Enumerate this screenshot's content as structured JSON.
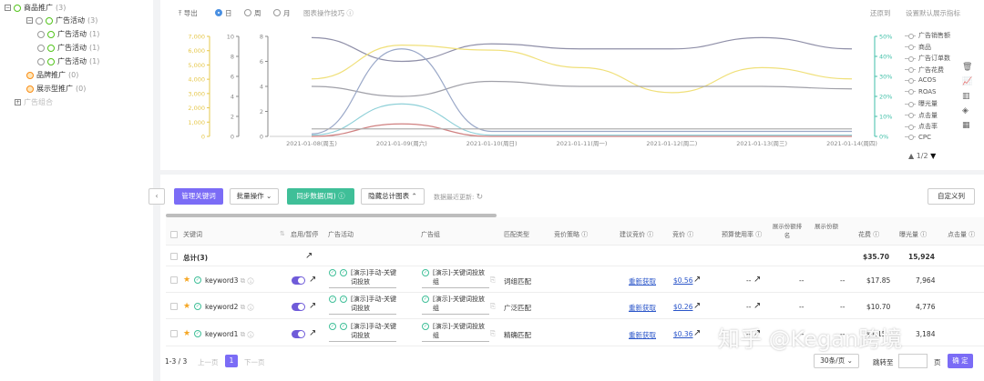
{
  "tree": {
    "items": [
      {
        "label": "商品推广",
        "count": "(3)"
      },
      {
        "label": "广告活动",
        "count": "(3)"
      },
      {
        "label": "广告活动",
        "count": "(1)"
      },
      {
        "label": "广告活动",
        "count": "(1)"
      },
      {
        "label": "广告活动",
        "count": "(1)"
      },
      {
        "label": "品牌推广",
        "count": "(0)"
      },
      {
        "label": "展示型推广",
        "count": "(0)"
      },
      {
        "label": "广告组合",
        "count": ""
      }
    ]
  },
  "chart_toolbar": {
    "export": "导出",
    "day": "日",
    "week": "周",
    "month": "月",
    "hint": "图表操作技巧",
    "rebase": "还原到",
    "settings": "设置默认展示指标"
  },
  "chart_data": {
    "type": "line",
    "x": [
      "2021-01-08(周五)",
      "2021-01-09(周六)",
      "2021-01-10(周日)",
      "2021-01-11(周一)",
      "2021-01-12(周二)",
      "2021-01-13(周三)",
      "2021-01-14(周四)"
    ],
    "y_axes": [
      {
        "ticks": [
          "0",
          "1,000",
          "2,000",
          "3,000",
          "4,000",
          "5,000",
          "6,000",
          "7,000"
        ],
        "color": "#e6c84c"
      },
      {
        "ticks": [
          "0",
          "2",
          "4",
          "6",
          "8",
          "10"
        ],
        "color": "#888888"
      },
      {
        "ticks": [
          "0",
          "2",
          "4",
          "6",
          "8"
        ],
        "color": "#888888"
      },
      {
        "ticks": [
          "0%",
          "10%",
          "20%",
          "30%",
          "40%",
          "50%"
        ],
        "color": "#3fbfa8"
      }
    ],
    "series": [
      {
        "name": "广告销售额",
        "color": "#8f8fa8",
        "values": [
          7.9,
          6.0,
          7.4,
          7.0,
          7.0,
          7.9,
          7.0
        ]
      },
      {
        "name": "曝光量",
        "color": "#f0e07a",
        "values": [
          4.6,
          7.3,
          6.9,
          5.5,
          3.5,
          5.5,
          4.6
        ]
      },
      {
        "name": "广告订单数",
        "color": "#a0a0a8",
        "values": [
          4.0,
          3.2,
          4.4,
          4.0,
          4.0,
          4.0,
          3.8
        ]
      },
      {
        "name": "点击量",
        "color": "#9aa8c8",
        "values": [
          0.2,
          7.0,
          0.4,
          0.4,
          0.4,
          0.4,
          0.4
        ]
      },
      {
        "name": "CPC",
        "color": "#8fd0d8",
        "values": [
          0.1,
          2.6,
          0.1,
          0.1,
          0.1,
          0.1,
          0.1
        ]
      },
      {
        "name": "广告花费",
        "color": "#d08080",
        "values": [
          0,
          1.0,
          0,
          0,
          0,
          0,
          0
        ]
      },
      {
        "name": "ACOS",
        "color": "#b0b0b0",
        "values": [
          0.6,
          0.6,
          0.6,
          0.6,
          0.6,
          0.6,
          0.6
        ]
      }
    ]
  },
  "legend": {
    "items": [
      "广告销售额",
      "商品",
      "广告订单数",
      "广告花费",
      "ACOS",
      "ROAS",
      "曝光量",
      "点击量",
      "点击率",
      "CPC"
    ],
    "page": "1/2"
  },
  "toolbar": {
    "manage_keywords": "管理关键词",
    "batch_ops": "批量操作",
    "sync_ads": "同步数据(周)",
    "hide_chart": "隐藏总计图表",
    "updated": "数据最近更新:",
    "custom_cols": "自定义列"
  },
  "table": {
    "headers": [
      "关键词",
      "启用/暂停",
      "广告活动",
      "广告组",
      "匹配类型",
      "竞价策略",
      "建议竞价",
      "竞价",
      "预算使用率",
      "展示份额排名",
      "展示份额",
      "排名",
      "花费",
      "曝光量",
      "点击量"
    ],
    "total": {
      "label": "总计(3)",
      "spend": "$35.70",
      "impr": "15,924"
    },
    "rows": [
      {
        "keyword": "keyword3",
        "campaign": "[演示]手动-关键词投放",
        "group": "[演示]-关键词投放组",
        "match": "词组匹配",
        "suggest": "重新获取",
        "bid": "$0.56",
        "budget": "--",
        "s1": "--",
        "s2": "--",
        "spend": "$17.85",
        "impr": "7,964"
      },
      {
        "keyword": "keyword2",
        "campaign": "[演示]手动-关键词投放",
        "group": "[演示]-关键词投放组",
        "match": "广泛匹配",
        "suggest": "重新获取",
        "bid": "$0.26",
        "budget": "--",
        "s1": "--",
        "s2": "--",
        "spend": "$10.70",
        "impr": "4,776"
      },
      {
        "keyword": "keyword1",
        "campaign": "[演示]手动-关键词投放",
        "group": "[演示]-关键词投放组",
        "match": "精确匹配",
        "suggest": "重新获取",
        "bid": "$0.36",
        "budget": "--",
        "s1": "--",
        "s2": "--",
        "spend": "$7.15",
        "impr": "3,184"
      }
    ]
  },
  "pagination": {
    "range": "1-3 / 3",
    "prev": "上一页",
    "page": "1",
    "next": "下一页",
    "per_page": "30条/页",
    "goto": "跳转至",
    "page_unit": "页",
    "confirm": "确 定"
  },
  "watermark": {
    "text": "知乎 @Kegan跨境"
  }
}
